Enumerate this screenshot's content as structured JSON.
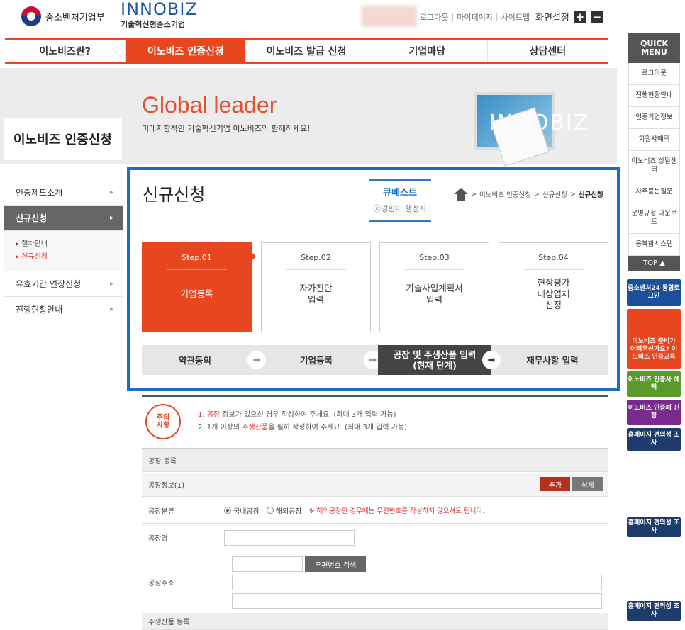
{
  "header": {
    "ministry": "중소벤처기업부",
    "brand": "INNOBIZ",
    "brand_sub": "기술혁신형중소기업",
    "util": {
      "logout": "로그아웃",
      "mypage": "마이페이지",
      "sitemap": "사이트맵",
      "zoom": "화면설정",
      "sep": "|"
    },
    "zoom_in": "+",
    "zoom_out": "−"
  },
  "nav": [
    "이노비즈란?",
    "이노비즈 인증신청",
    "이노비즈 발급 신청",
    "기업마당",
    "상담센터"
  ],
  "banner": {
    "title": "Global leader",
    "subtitle": "미래지향적인 기술혁신기업 이노비즈와 함께하세요!",
    "monitor_text": "INNOBIZ"
  },
  "section_label": "이노비즈 인증신청",
  "sidebar": {
    "items": [
      {
        "label": "인증제도소개"
      },
      {
        "label": "신규신청"
      },
      {
        "label": "유효기간 연장신청"
      },
      {
        "label": "진행현황안내"
      }
    ],
    "subitems": [
      {
        "label": "▸ 절차안내"
      },
      {
        "label": "▸ 신규신청"
      }
    ],
    "arrow": "▸"
  },
  "page_title": "신규신청",
  "cubest": {
    "name": "큐베스트",
    "sub": "ⓒ경향아 행정사"
  },
  "breadcrumb": {
    "sep": ">",
    "items": [
      "이노비즈 인증신청",
      "신규신청",
      "신규신청"
    ]
  },
  "steps": [
    {
      "no": "Step.01",
      "name": "기업등록"
    },
    {
      "no": "Step.02",
      "name": "자가진단\n입력"
    },
    {
      "no": "Step.03",
      "name": "기술사업계획서\n입력"
    },
    {
      "no": "Step.04",
      "name": "현장평가\n대상업체\n선정"
    }
  ],
  "substeps": [
    {
      "label": "약관동의"
    },
    {
      "label": "기업등록"
    },
    {
      "label": "공장 및 주생산품 입력",
      "note": "(현재 단계)"
    },
    {
      "label": "재무사항 입력"
    }
  ],
  "arrow_glyph": "➡",
  "caution": {
    "badge1": "주의",
    "badge2": "사항",
    "line1_pre": "1. ",
    "line1_hl": "공장",
    "line1_post": " 정보가 있으신 경우 작성하여 주세요. (최대 3개 입력 가능)",
    "line2_pre": "2. 1개 이상의 ",
    "line2_hl": "주생산품",
    "line2_post": "을 필히 작성하여 주세요. (최대 3개 입력 가능)"
  },
  "form": {
    "factory_section": "공장 등록",
    "factory_info": "공장정보(1)",
    "btn_add": "추가",
    "btn_del": "삭제",
    "type_label": "공장분류",
    "radio_domestic": "국내공장",
    "radio_overseas": "해외공장",
    "overseas_note": "※ 해외공장인 경우에는 우편번호를 작성하지 않으셔도 됩니다.",
    "name_label": "공장명",
    "address_label": "공장주소",
    "zip_button": "우편번호 검색",
    "product_section": "주생산품 등록"
  },
  "quick": {
    "head": "QUICK MENU",
    "items": [
      "로그아웃",
      "진행현황안내",
      "인증기업정보",
      "회원사혜택",
      "이노비즈 상담센터",
      "자주묻는질문",
      "운영규정 다운로드",
      "융복합시스템"
    ],
    "top": "TOP ▲"
  },
  "promos": [
    {
      "label": "중소벤처24 통합로그인",
      "color": "#1d4f9c"
    },
    {
      "label": "이노비즈 준비가 어려우신가요? 이노비즈 인증교육",
      "color": "#e8461e"
    },
    {
      "label": "이노비즈 인증사 혜택",
      "color": "#5a9a2a"
    },
    {
      "label": "이노비즈 인증패 신청",
      "color": "#7a2a8e"
    },
    {
      "label": "홈페이지 편의성 조사",
      "color": "#1d3c6c"
    },
    {
      "label": "홈페이지 편의성 조사",
      "color": "#1d3c6c"
    },
    {
      "label": "홈페이지 편의성 조사",
      "color": "#1d3c6c"
    }
  ]
}
